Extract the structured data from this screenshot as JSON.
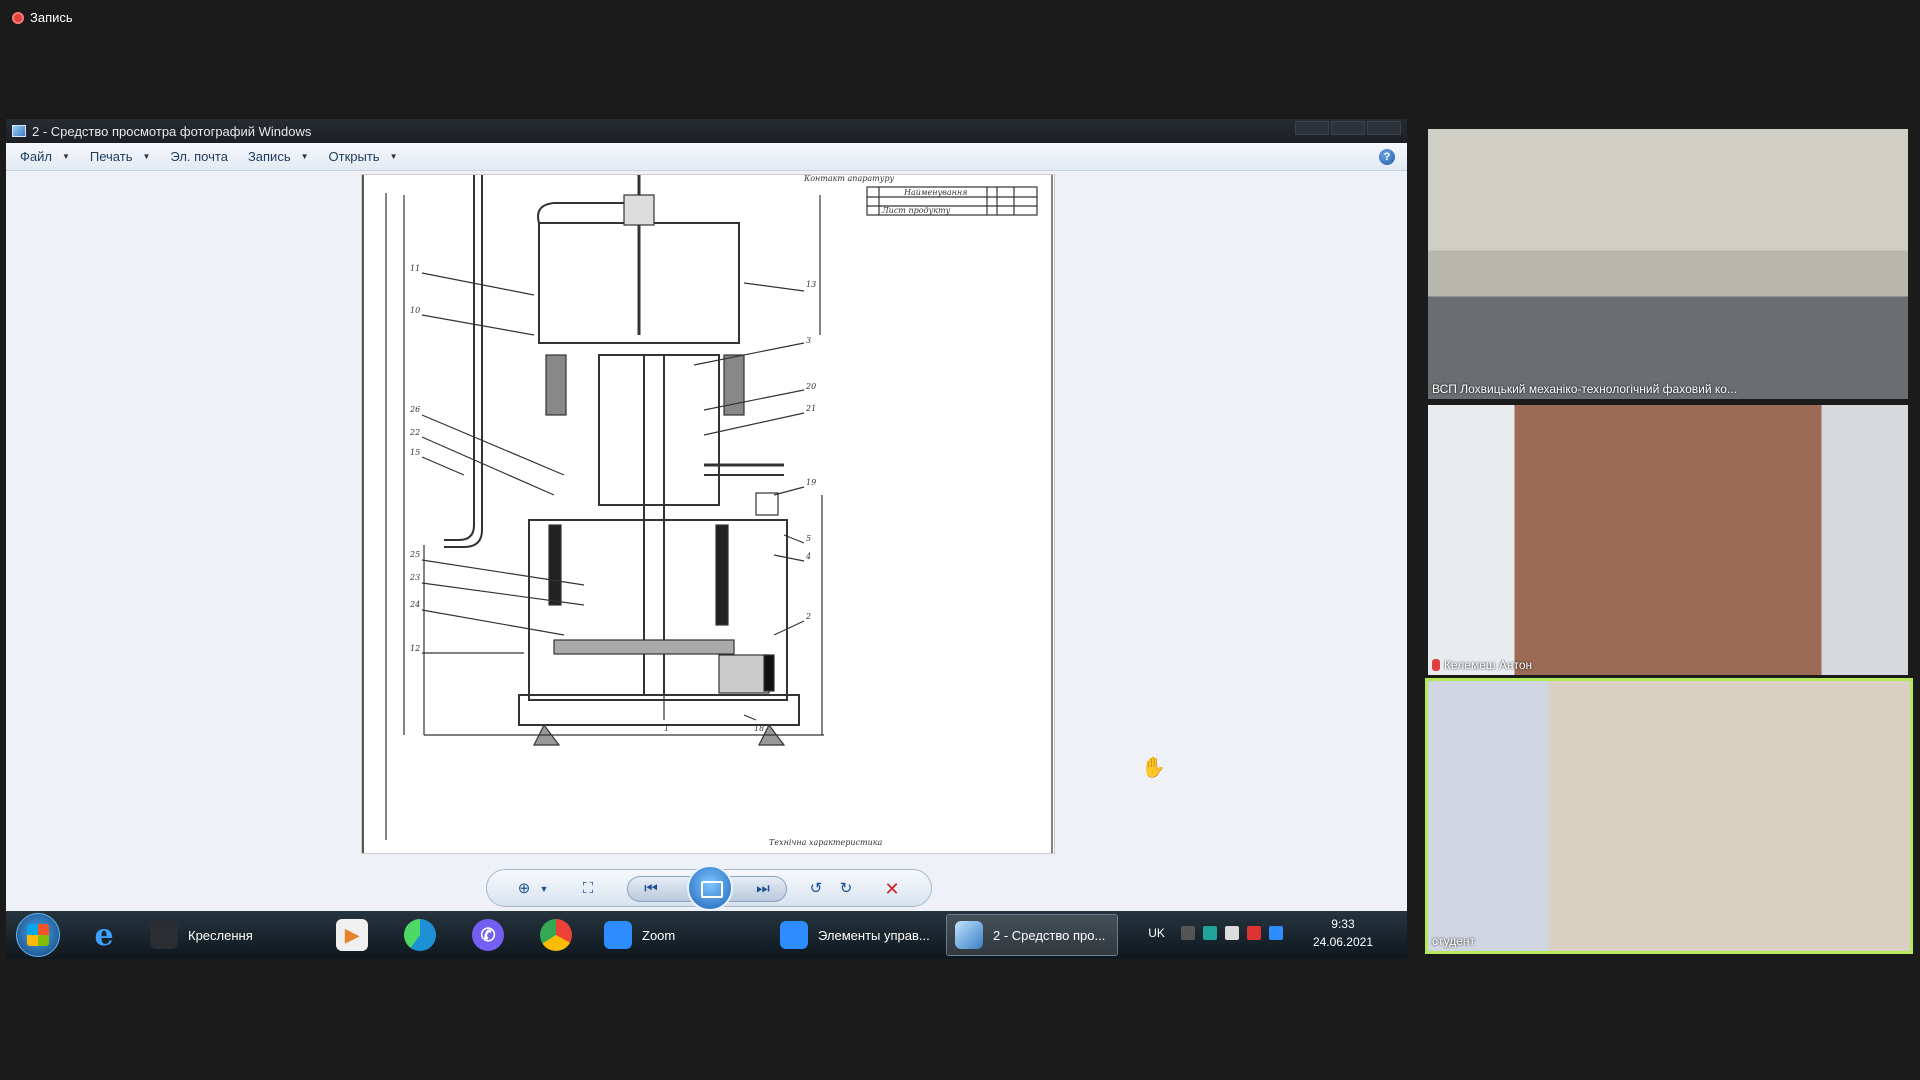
{
  "recording": {
    "label": "Запись"
  },
  "viewer": {
    "window_title": "2 - Средство просмотра фотографий Windows",
    "menu": [
      {
        "label": "Файл",
        "has_dropdown": true
      },
      {
        "label": "Печать",
        "has_dropdown": true
      },
      {
        "label": "Эл. почта",
        "has_dropdown": false
      },
      {
        "label": "Запись",
        "has_dropdown": true
      },
      {
        "label": "Открыть",
        "has_dropdown": true
      }
    ],
    "help_label": "?",
    "drawing": {
      "header_text": "Контакт апаратуру",
      "table_col1": "Найменування",
      "table_row": "Лист продукту",
      "caption": "Технічна характеристика",
      "numbers": [
        "11",
        "10",
        "26",
        "22",
        "15",
        "25",
        "23",
        "24",
        "12",
        "13",
        "3",
        "20",
        "21",
        "19",
        "5",
        "4",
        "2",
        "1",
        "18"
      ]
    },
    "icons": {
      "zoom": "zoom-icon",
      "fit": "fit-to-window-icon",
      "previous": "previous-icon",
      "slideshow": "slideshow-icon",
      "next": "next-icon",
      "rotate_ccw": "rotate-counterclockwise-icon",
      "rotate_cw": "rotate-clockwise-icon",
      "delete": "delete-icon"
    }
  },
  "taskbar": {
    "tasks": [
      {
        "label": "Креслення"
      },
      {
        "label": "Zoom"
      },
      {
        "label": "Элементы управ..."
      },
      {
        "label": "2 - Средство про..."
      }
    ],
    "language": "UK",
    "time": "9:33",
    "date": "24.06.2021"
  },
  "participants": [
    {
      "name": "ВСП Лохвицький механіко-технологічний фаховий ко...",
      "muted": false
    },
    {
      "name": "Келемеш Антон",
      "muted": true
    },
    {
      "name": "студент",
      "muted": false,
      "active_speaker": true
    }
  ]
}
